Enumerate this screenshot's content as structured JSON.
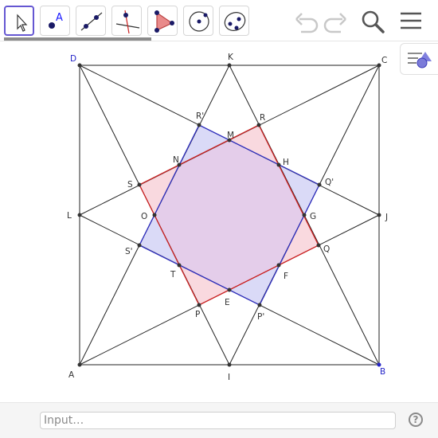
{
  "toolbar": {
    "tools": [
      {
        "name": "move-tool",
        "icon": "cursor-arrow-icon",
        "active": true
      },
      {
        "name": "point-tool",
        "icon": "point-icon",
        "active": false,
        "label": "A"
      },
      {
        "name": "line-tool",
        "icon": "line-through-points-icon",
        "active": false
      },
      {
        "name": "perpendicular-line-tool",
        "icon": "perpendicular-line-icon",
        "active": false
      },
      {
        "name": "polygon-tool",
        "icon": "polygon-icon",
        "active": false
      },
      {
        "name": "circle-tool",
        "icon": "circle-center-point-icon",
        "active": false
      },
      {
        "name": "conic-tool",
        "icon": "ellipse-icon",
        "active": false
      }
    ],
    "undo_icon": "undo-icon",
    "redo_icon": "redo-icon",
    "search_icon": "search-icon",
    "menu_icon": "hamburger-menu-icon"
  },
  "style_bar_icon": "style-bar-toggle-icon",
  "colors": {
    "blue_polygon": "#2f2fbf",
    "red_polygon": "#cc2222",
    "blue_fill": "#dadaf7",
    "red_fill": "#f9d9df",
    "overlap_fill": "#e4cdea",
    "blue_label": "#2525c8"
  },
  "construction": {
    "labels": {
      "A": "A",
      "B": "B",
      "C": "C",
      "D": "D",
      "I": "I",
      "J": "J",
      "K": "K",
      "L": "L",
      "M": "M",
      "N": "N",
      "O": "O",
      "T": "T",
      "E": "E",
      "F": "F",
      "G": "G",
      "H": "H",
      "P": "P",
      "Q": "Q",
      "R": "R",
      "S": "S",
      "Pp": "P'",
      "Qp": "Q'",
      "Rp": "R'",
      "Sp": "S'"
    }
  },
  "input_bar": {
    "placeholder": "Input…",
    "help_label": "?"
  }
}
